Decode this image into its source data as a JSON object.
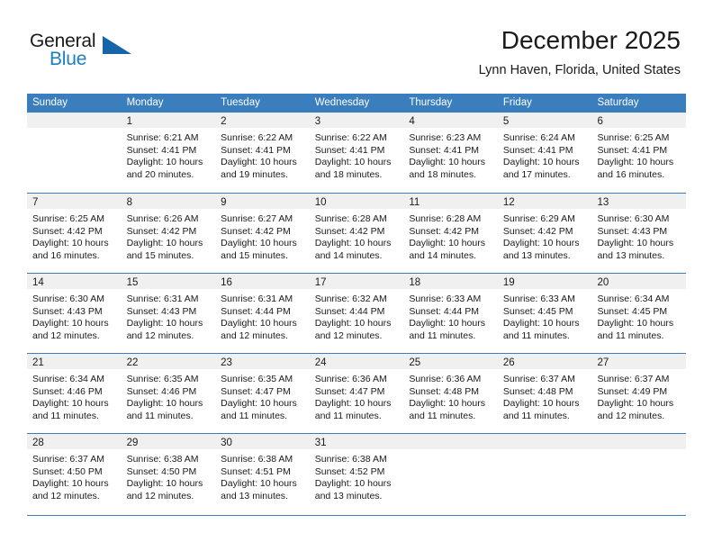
{
  "brand": {
    "name_part1": "General",
    "name_part2": "Blue",
    "triangle_icon": "triangle-icon",
    "accent_color": "#1d7fc3"
  },
  "header": {
    "title": "December 2025",
    "subtitle": "Lynn Haven, Florida, United States"
  },
  "calendar": {
    "header_bg": "#3a7ebd",
    "daynum_band_bg": "#f0f0f0",
    "weekdays": [
      "Sunday",
      "Monday",
      "Tuesday",
      "Wednesday",
      "Thursday",
      "Friday",
      "Saturday"
    ],
    "weeks": [
      [
        {
          "day": "",
          "lines": []
        },
        {
          "day": "1",
          "lines": [
            "Sunrise: 6:21 AM",
            "Sunset: 4:41 PM",
            "Daylight: 10 hours",
            "and 20 minutes."
          ]
        },
        {
          "day": "2",
          "lines": [
            "Sunrise: 6:22 AM",
            "Sunset: 4:41 PM",
            "Daylight: 10 hours",
            "and 19 minutes."
          ]
        },
        {
          "day": "3",
          "lines": [
            "Sunrise: 6:22 AM",
            "Sunset: 4:41 PM",
            "Daylight: 10 hours",
            "and 18 minutes."
          ]
        },
        {
          "day": "4",
          "lines": [
            "Sunrise: 6:23 AM",
            "Sunset: 4:41 PM",
            "Daylight: 10 hours",
            "and 18 minutes."
          ]
        },
        {
          "day": "5",
          "lines": [
            "Sunrise: 6:24 AM",
            "Sunset: 4:41 PM",
            "Daylight: 10 hours",
            "and 17 minutes."
          ]
        },
        {
          "day": "6",
          "lines": [
            "Sunrise: 6:25 AM",
            "Sunset: 4:41 PM",
            "Daylight: 10 hours",
            "and 16 minutes."
          ]
        }
      ],
      [
        {
          "day": "7",
          "lines": [
            "Sunrise: 6:25 AM",
            "Sunset: 4:42 PM",
            "Daylight: 10 hours",
            "and 16 minutes."
          ]
        },
        {
          "day": "8",
          "lines": [
            "Sunrise: 6:26 AM",
            "Sunset: 4:42 PM",
            "Daylight: 10 hours",
            "and 15 minutes."
          ]
        },
        {
          "day": "9",
          "lines": [
            "Sunrise: 6:27 AM",
            "Sunset: 4:42 PM",
            "Daylight: 10 hours",
            "and 15 minutes."
          ]
        },
        {
          "day": "10",
          "lines": [
            "Sunrise: 6:28 AM",
            "Sunset: 4:42 PM",
            "Daylight: 10 hours",
            "and 14 minutes."
          ]
        },
        {
          "day": "11",
          "lines": [
            "Sunrise: 6:28 AM",
            "Sunset: 4:42 PM",
            "Daylight: 10 hours",
            "and 14 minutes."
          ]
        },
        {
          "day": "12",
          "lines": [
            "Sunrise: 6:29 AM",
            "Sunset: 4:42 PM",
            "Daylight: 10 hours",
            "and 13 minutes."
          ]
        },
        {
          "day": "13",
          "lines": [
            "Sunrise: 6:30 AM",
            "Sunset: 4:43 PM",
            "Daylight: 10 hours",
            "and 13 minutes."
          ]
        }
      ],
      [
        {
          "day": "14",
          "lines": [
            "Sunrise: 6:30 AM",
            "Sunset: 4:43 PM",
            "Daylight: 10 hours",
            "and 12 minutes."
          ]
        },
        {
          "day": "15",
          "lines": [
            "Sunrise: 6:31 AM",
            "Sunset: 4:43 PM",
            "Daylight: 10 hours",
            "and 12 minutes."
          ]
        },
        {
          "day": "16",
          "lines": [
            "Sunrise: 6:31 AM",
            "Sunset: 4:44 PM",
            "Daylight: 10 hours",
            "and 12 minutes."
          ]
        },
        {
          "day": "17",
          "lines": [
            "Sunrise: 6:32 AM",
            "Sunset: 4:44 PM",
            "Daylight: 10 hours",
            "and 12 minutes."
          ]
        },
        {
          "day": "18",
          "lines": [
            "Sunrise: 6:33 AM",
            "Sunset: 4:44 PM",
            "Daylight: 10 hours",
            "and 11 minutes."
          ]
        },
        {
          "day": "19",
          "lines": [
            "Sunrise: 6:33 AM",
            "Sunset: 4:45 PM",
            "Daylight: 10 hours",
            "and 11 minutes."
          ]
        },
        {
          "day": "20",
          "lines": [
            "Sunrise: 6:34 AM",
            "Sunset: 4:45 PM",
            "Daylight: 10 hours",
            "and 11 minutes."
          ]
        }
      ],
      [
        {
          "day": "21",
          "lines": [
            "Sunrise: 6:34 AM",
            "Sunset: 4:46 PM",
            "Daylight: 10 hours",
            "and 11 minutes."
          ]
        },
        {
          "day": "22",
          "lines": [
            "Sunrise: 6:35 AM",
            "Sunset: 4:46 PM",
            "Daylight: 10 hours",
            "and 11 minutes."
          ]
        },
        {
          "day": "23",
          "lines": [
            "Sunrise: 6:35 AM",
            "Sunset: 4:47 PM",
            "Daylight: 10 hours",
            "and 11 minutes."
          ]
        },
        {
          "day": "24",
          "lines": [
            "Sunrise: 6:36 AM",
            "Sunset: 4:47 PM",
            "Daylight: 10 hours",
            "and 11 minutes."
          ]
        },
        {
          "day": "25",
          "lines": [
            "Sunrise: 6:36 AM",
            "Sunset: 4:48 PM",
            "Daylight: 10 hours",
            "and 11 minutes."
          ]
        },
        {
          "day": "26",
          "lines": [
            "Sunrise: 6:37 AM",
            "Sunset: 4:48 PM",
            "Daylight: 10 hours",
            "and 11 minutes."
          ]
        },
        {
          "day": "27",
          "lines": [
            "Sunrise: 6:37 AM",
            "Sunset: 4:49 PM",
            "Daylight: 10 hours",
            "and 12 minutes."
          ]
        }
      ],
      [
        {
          "day": "28",
          "lines": [
            "Sunrise: 6:37 AM",
            "Sunset: 4:50 PM",
            "Daylight: 10 hours",
            "and 12 minutes."
          ]
        },
        {
          "day": "29",
          "lines": [
            "Sunrise: 6:38 AM",
            "Sunset: 4:50 PM",
            "Daylight: 10 hours",
            "and 12 minutes."
          ]
        },
        {
          "day": "30",
          "lines": [
            "Sunrise: 6:38 AM",
            "Sunset: 4:51 PM",
            "Daylight: 10 hours",
            "and 13 minutes."
          ]
        },
        {
          "day": "31",
          "lines": [
            "Sunrise: 6:38 AM",
            "Sunset: 4:52 PM",
            "Daylight: 10 hours",
            "and 13 minutes."
          ]
        },
        {
          "day": "",
          "lines": []
        },
        {
          "day": "",
          "lines": []
        },
        {
          "day": "",
          "lines": []
        }
      ]
    ]
  }
}
